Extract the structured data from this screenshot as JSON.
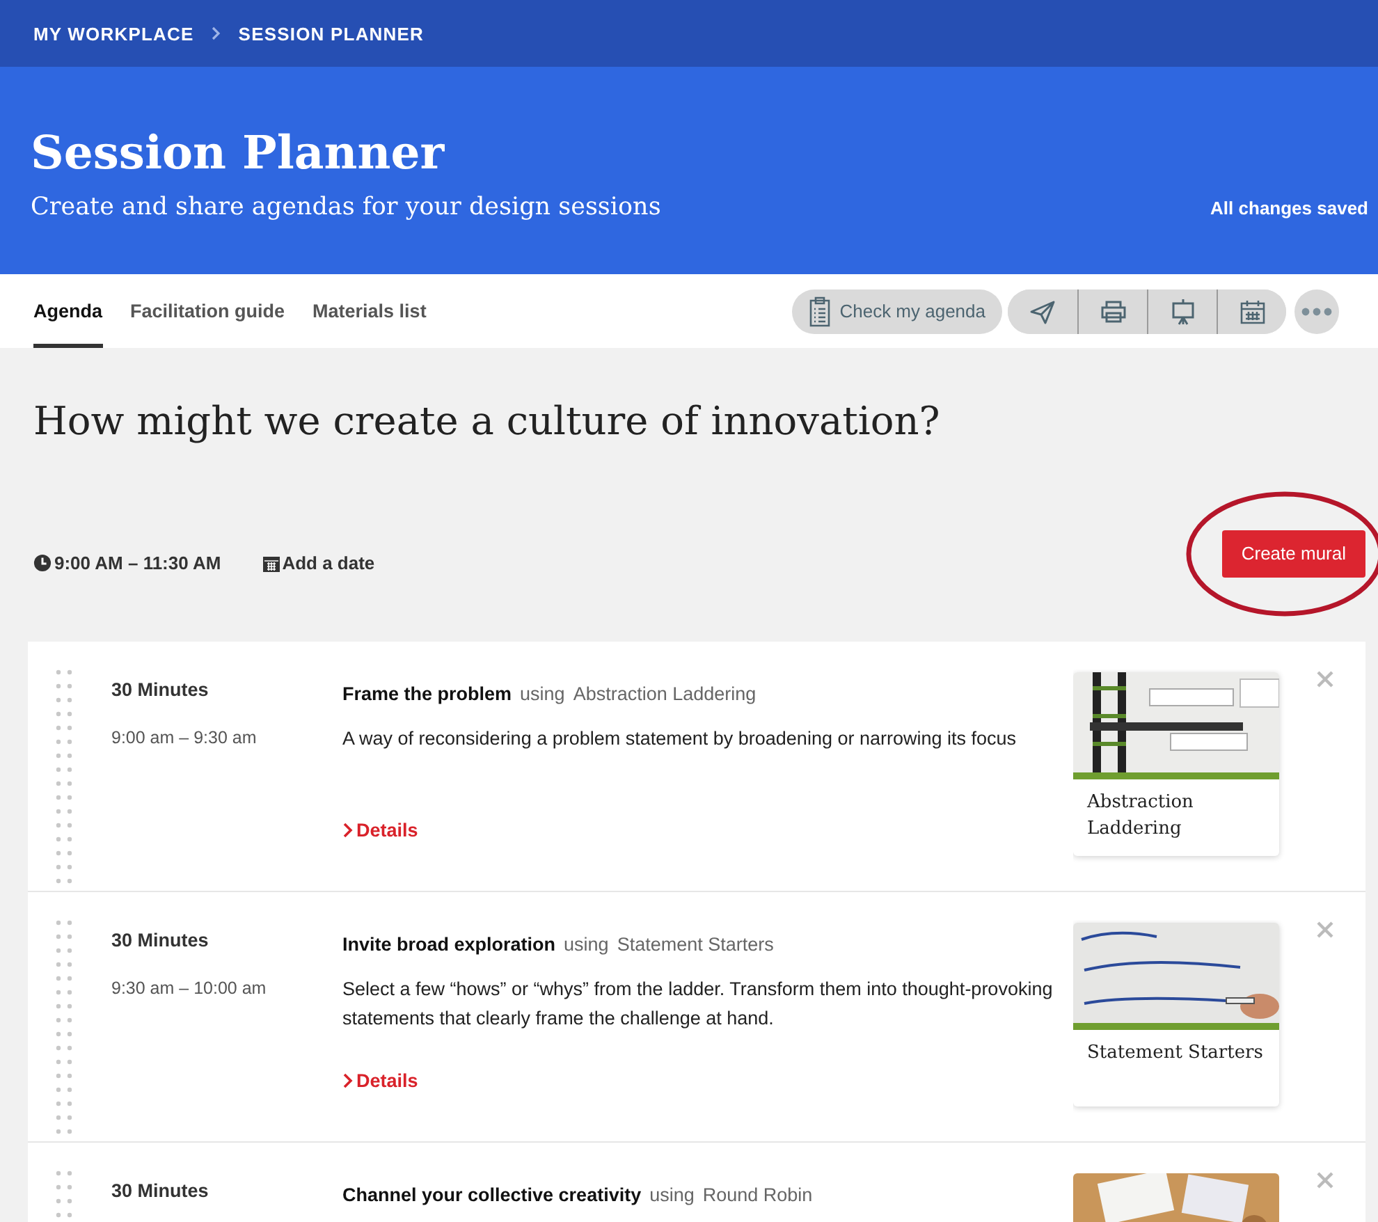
{
  "breadcrumbs": [
    {
      "label": "MY WORKPLACE"
    },
    {
      "label": "SESSION PLANNER"
    }
  ],
  "header": {
    "title": "Session Planner",
    "subtitle": "Create and share agendas for your design sessions",
    "save_status": "All changes saved"
  },
  "tabs": [
    {
      "label": "Agenda",
      "selected": true
    },
    {
      "label": "Facilitation guide",
      "selected": false
    },
    {
      "label": "Materials list",
      "selected": false
    }
  ],
  "toolbar": {
    "check_button": "Check my agenda"
  },
  "session": {
    "question": "How might we create a culture of innovation?",
    "time_range": "9:00 AM – 11:30 AM",
    "add_date": "Add a date",
    "create_button": "Create mural",
    "create_button_highlighted": true
  },
  "activities": [
    {
      "duration": "30 Minutes",
      "time": "9:00 am – 9:30 am",
      "title": "Frame the problem",
      "using": "using",
      "method": "Abstraction Laddering",
      "description": "A way of reconsidering a problem statement by broadening or narrowing its focus",
      "details": "Details",
      "card_title": "Abstraction Laddering"
    },
    {
      "duration": "30 Minutes",
      "time": "9:30 am – 10:00 am",
      "title": "Invite broad exploration",
      "using": "using",
      "method": "Statement Starters",
      "description": "Select a few “hows” or “whys” from the ladder. Transform them into thought-provoking statements that clearly frame the challenge at hand.",
      "details": "Details",
      "card_title": "Statement Starters"
    },
    {
      "duration": "30 Minutes",
      "title": "Channel your collective creativity",
      "using": "using",
      "method": "Round Robin"
    }
  ]
}
